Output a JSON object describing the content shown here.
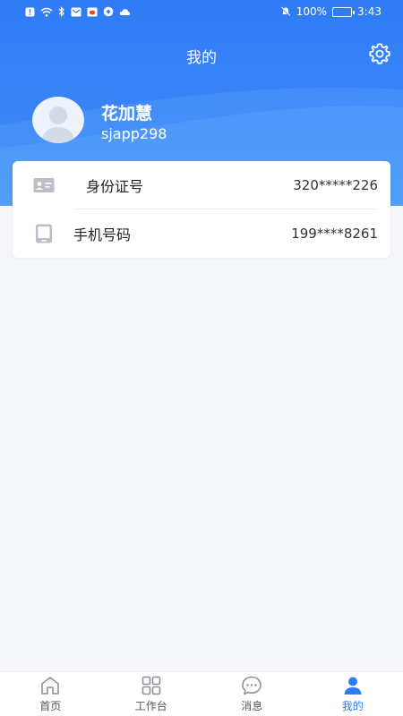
{
  "status_bar": {
    "battery": "100%",
    "time": "3:43"
  },
  "header": {
    "title": "我的"
  },
  "profile": {
    "name": "花加慧",
    "username": "sjapp298"
  },
  "info": {
    "rows": [
      {
        "label": "身份证号",
        "value": "320*****226",
        "icon": "id-card-icon"
      },
      {
        "label": "手机号码",
        "value": "199****8261",
        "icon": "phone-icon"
      }
    ]
  },
  "tabbar": {
    "tabs": [
      {
        "label": "首页",
        "icon": "home-icon"
      },
      {
        "label": "工作台",
        "icon": "grid-icon"
      },
      {
        "label": "消息",
        "icon": "message-icon"
      },
      {
        "label": "我的",
        "icon": "user-icon",
        "active": true
      }
    ]
  },
  "colors": {
    "primary": "#2f7bf6",
    "background": "#f4f6fa",
    "icon_gray": "#b9bfc9"
  }
}
